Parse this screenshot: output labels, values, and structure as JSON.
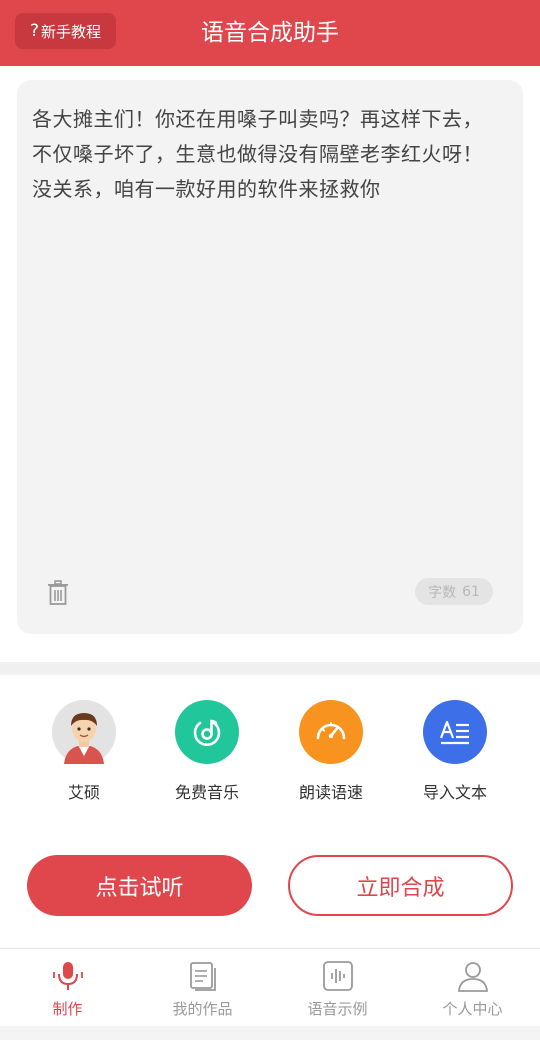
{
  "header": {
    "tutorial_icon": "?",
    "tutorial_label": "新手教程",
    "title": "语音合成助手"
  },
  "editor": {
    "text_lines": [
      "各大摊主们！你还在用嗓子叫卖吗？再这样下去，",
      "不仅嗓子坏了，生意也做得没有隔壁老李红火呀！",
      "没关系，咱有一款好用的软件来拯救你"
    ],
    "count_label": "字数",
    "count_value": "61",
    "trash_icon": "trash-icon"
  },
  "features": [
    {
      "label": "艾硕",
      "icon": "avatar-icon",
      "color": "#e5e5e5"
    },
    {
      "label": "免费音乐",
      "icon": "music-icon",
      "color": "#21c79a"
    },
    {
      "label": "朗读语速",
      "icon": "speedometer-icon",
      "color": "#f7931e"
    },
    {
      "label": "导入文本",
      "icon": "import-text-icon",
      "color": "#3d6fe8"
    }
  ],
  "actions": {
    "preview_label": "点击试听",
    "synthesize_label": "立即合成"
  },
  "tabs": [
    {
      "label": "制作",
      "icon": "microphone-icon",
      "active": true
    },
    {
      "label": "我的作品",
      "icon": "files-icon",
      "active": false
    },
    {
      "label": "语音示例",
      "icon": "audio-wave-icon",
      "active": false
    },
    {
      "label": "个人中心",
      "icon": "user-icon",
      "active": false
    }
  ],
  "colors": {
    "brand": "#e0474d",
    "brand_dark": "#c7393f"
  }
}
